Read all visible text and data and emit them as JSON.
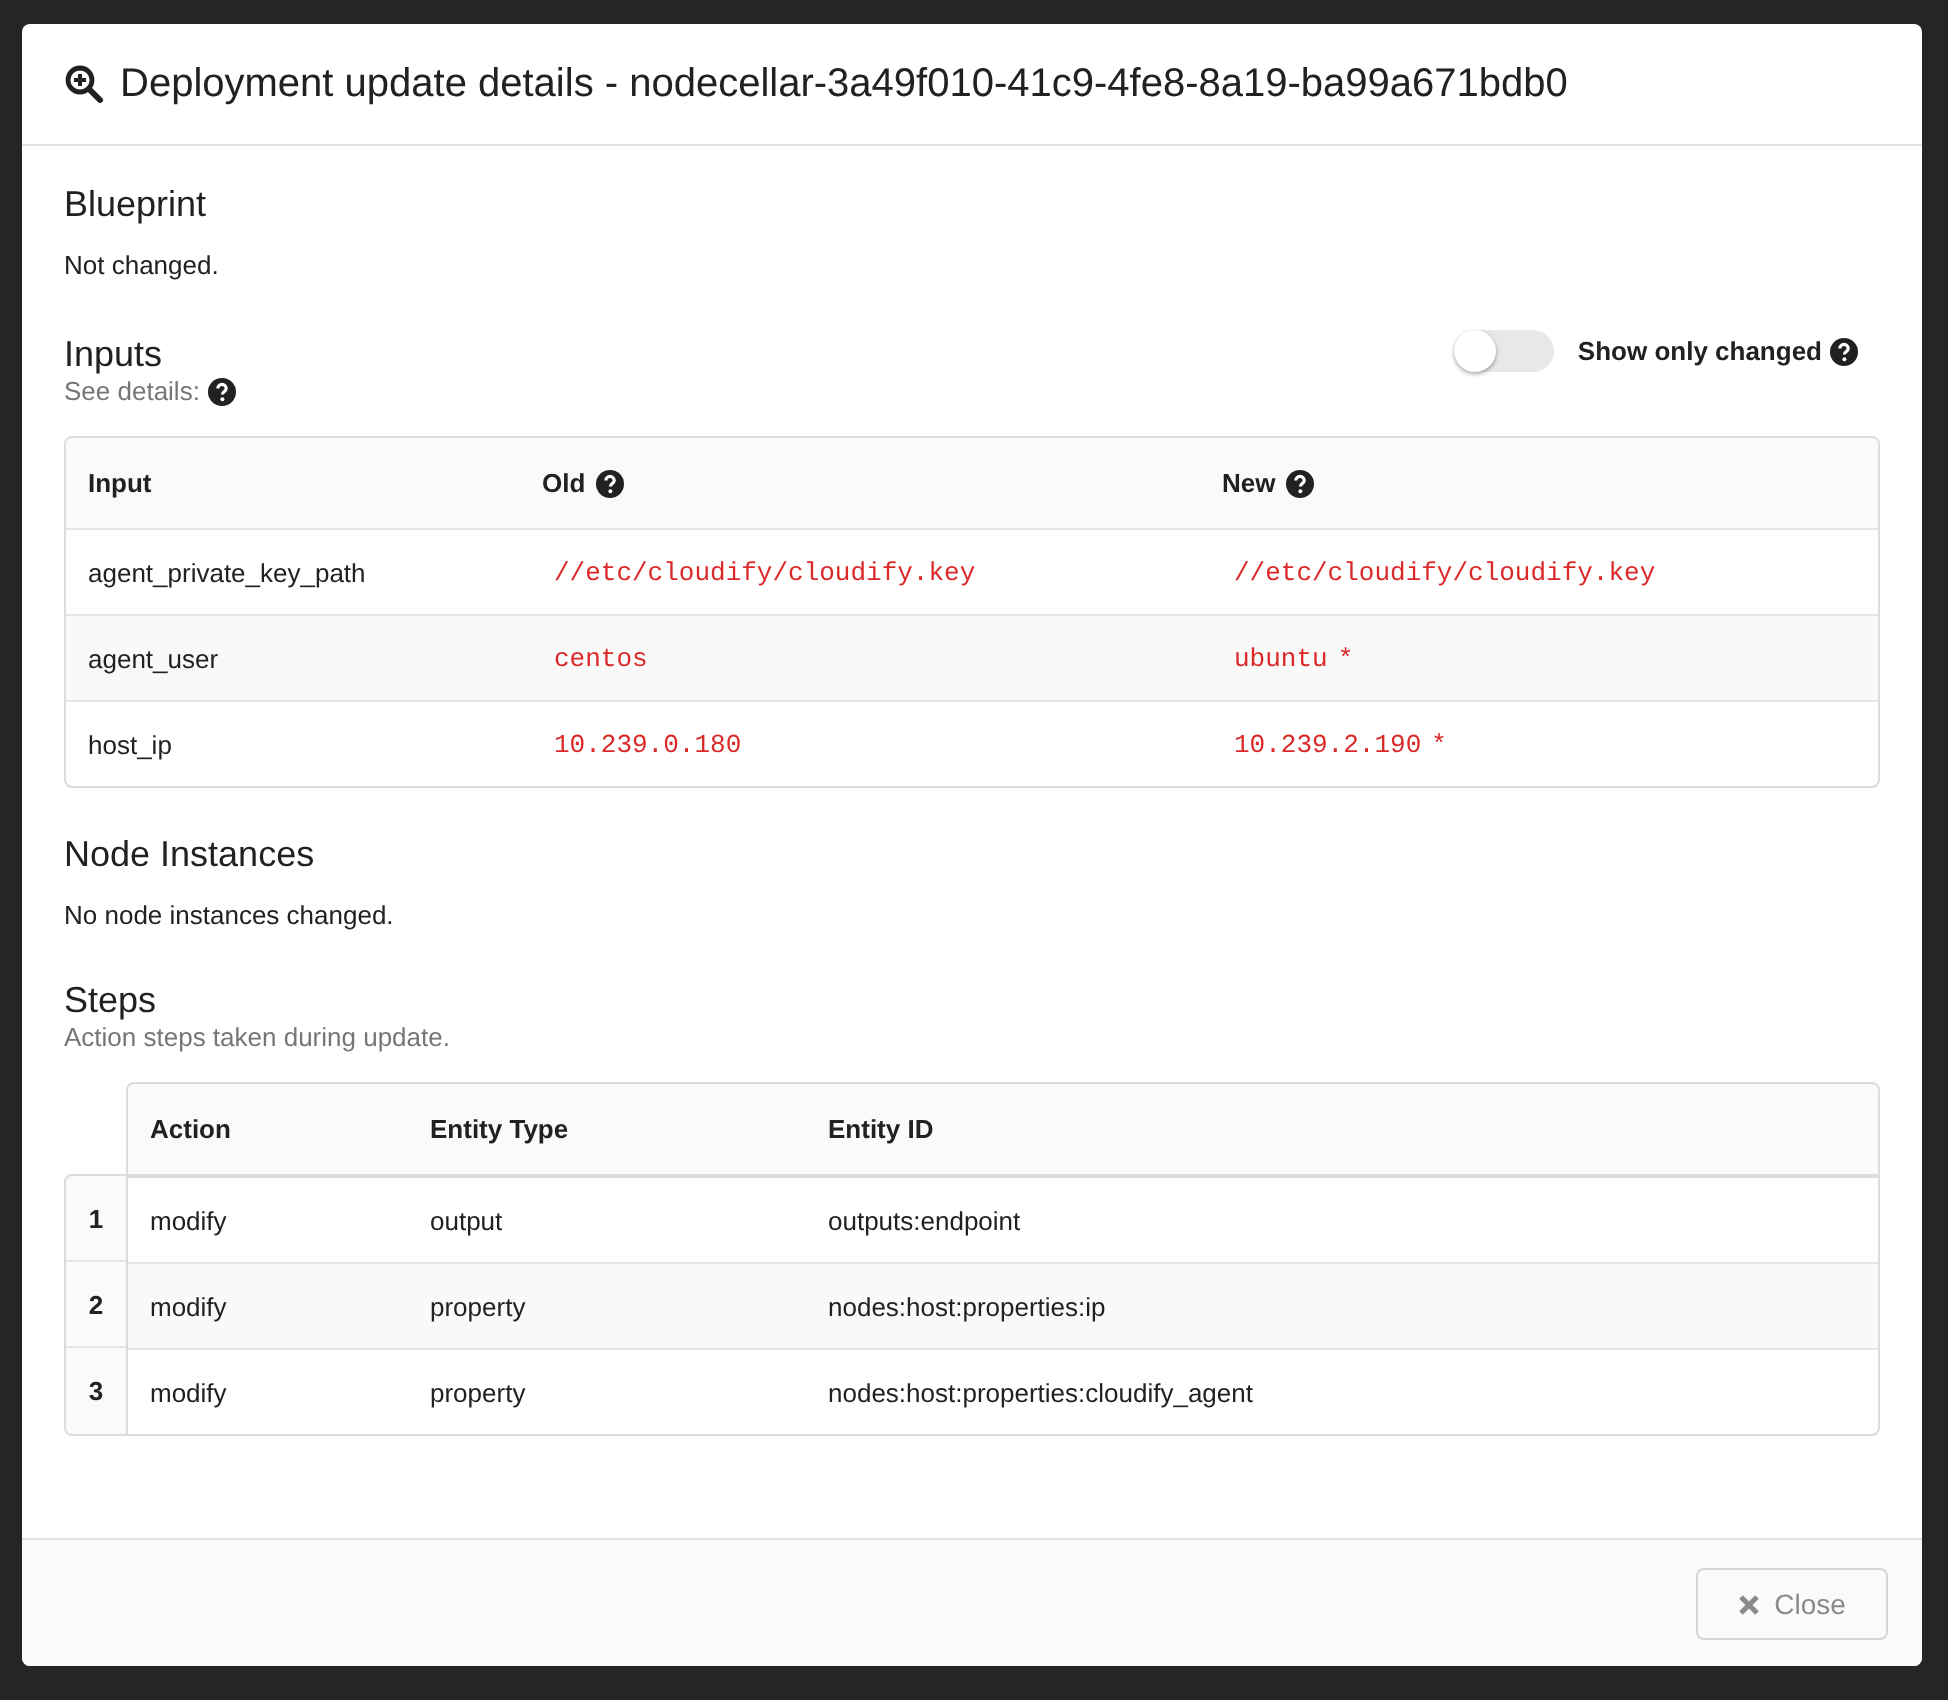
{
  "modal": {
    "title": "Deployment update details - nodecellar-3a49f010-41c9-4fe8-8a19-ba99a671bdb0"
  },
  "blueprint": {
    "heading": "Blueprint",
    "text": "Not changed."
  },
  "inputs": {
    "heading": "Inputs",
    "subheading": "See details:",
    "toggle": {
      "label": "Show only changed",
      "on": false
    },
    "columns": [
      "Input",
      "Old",
      "New"
    ],
    "changed_marker": "*",
    "rows": [
      {
        "input": "agent_private_key_path",
        "old": "//etc/cloudify/cloudify.key",
        "new": "//etc/cloudify/cloudify.key",
        "changed": false
      },
      {
        "input": "agent_user",
        "old": "centos",
        "new": "ubuntu",
        "changed": true
      },
      {
        "input": "host_ip",
        "old": "10.239.0.180",
        "new": "10.239.2.190",
        "changed": true
      }
    ]
  },
  "node_instances": {
    "heading": "Node Instances",
    "text": "No node instances changed."
  },
  "steps": {
    "heading": "Steps",
    "subheading": "Action steps taken during update.",
    "columns": [
      "Action",
      "Entity Type",
      "Entity ID"
    ],
    "rows": [
      {
        "number": "1",
        "action": "modify",
        "entity_type": "output",
        "entity_id": "outputs:endpoint"
      },
      {
        "number": "2",
        "action": "modify",
        "entity_type": "property",
        "entity_id": "nodes:host:properties:ip"
      },
      {
        "number": "3",
        "action": "modify",
        "entity_type": "property",
        "entity_id": "nodes:host:properties:cloudify_agent"
      }
    ]
  },
  "footer": {
    "close_button": "Close"
  }
}
